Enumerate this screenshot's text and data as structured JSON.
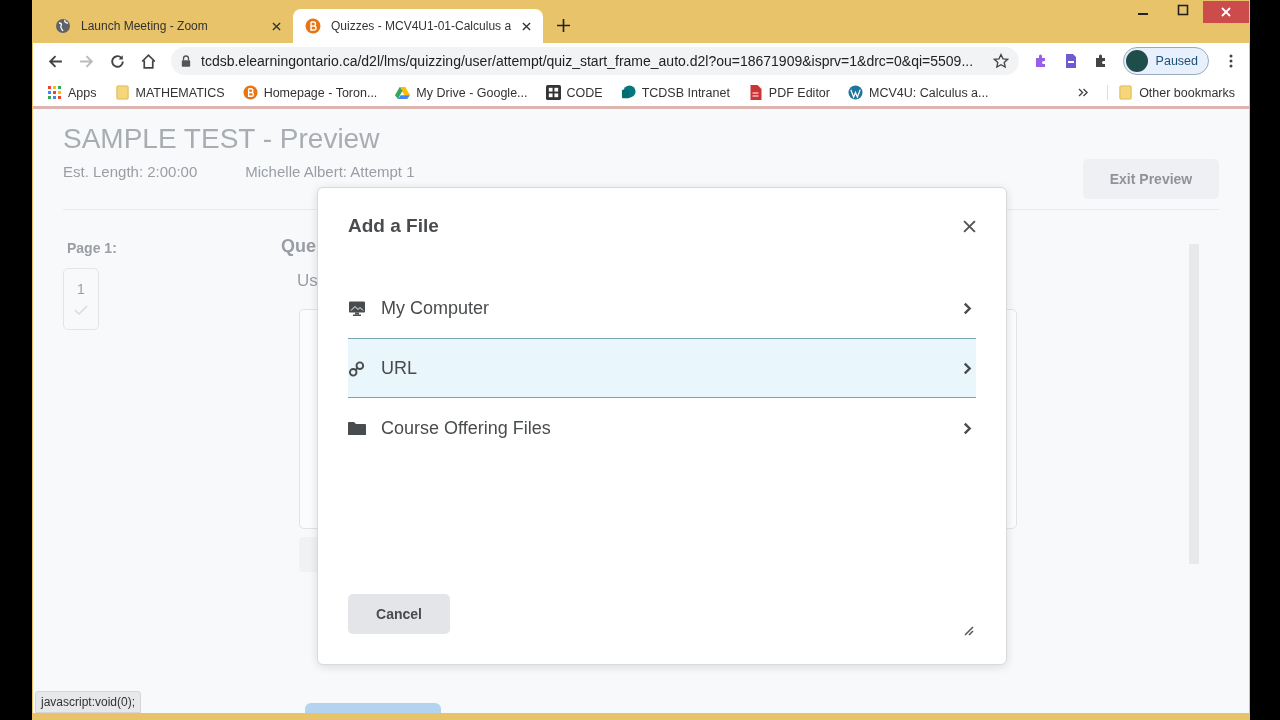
{
  "browser": {
    "tabs": [
      {
        "title": "Launch Meeting - Zoom",
        "selected": false
      },
      {
        "title": "Quizzes - MCV4U1-01-Calculus a",
        "selected": true
      }
    ],
    "address": "tcdsb.elearningontario.ca/d2l/lms/quizzing/user/attempt/quiz_start_frame_auto.d2l?ou=18671909&isprv=1&drc=0&qi=5509...",
    "profile_status": "Paused",
    "bookmarks": [
      "Apps",
      "MATHEMATICS",
      "Homepage - Toron...",
      "My Drive - Google...",
      "CODE",
      "TCDSB Intranet",
      "PDF Editor",
      "MCV4U: Calculus a..."
    ],
    "other_bookmarks": "Other bookmarks"
  },
  "page": {
    "title": "SAMPLE TEST - Preview",
    "est_length": "Est. Length: 2:00:00",
    "attempt": "Michelle Albert: Attempt 1",
    "exit_button": "Exit Preview",
    "page_label": "Page 1:",
    "question_number": "1",
    "question_answered": true,
    "question_heading": "Que",
    "question_text": "Us"
  },
  "dialog": {
    "title": "Add a File",
    "options": [
      {
        "label": "My Computer",
        "selected": false
      },
      {
        "label": "URL",
        "selected": true
      },
      {
        "label": "Course Offering Files",
        "selected": false
      }
    ],
    "cancel_button": "Cancel"
  },
  "status_bar": "javascript:void(0);"
}
